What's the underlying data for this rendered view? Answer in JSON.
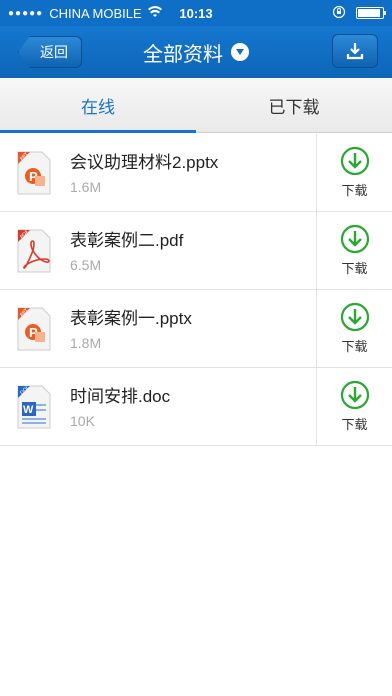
{
  "status": {
    "carrier": "CHINA MOBILE",
    "time": "10:13"
  },
  "nav": {
    "back_label": "返回",
    "title": "全部资料"
  },
  "tabs": [
    {
      "label": "在线",
      "active": true
    },
    {
      "label": "已下载",
      "active": false
    }
  ],
  "files": [
    {
      "name": "会议助理材料2.pptx",
      "size": "1.6M",
      "type": "ppt",
      "action": "下载"
    },
    {
      "name": "表彰案例二.pdf",
      "size": "6.5M",
      "type": "pdf",
      "action": "下载"
    },
    {
      "name": "表彰案例一.pptx",
      "size": "1.8M",
      "type": "ppt",
      "action": "下载"
    },
    {
      "name": "时间安排.doc",
      "size": "10K",
      "type": "doc",
      "action": "下载"
    }
  ],
  "colors": {
    "brand_blue": "#0f6fc6",
    "download_green": "#2aa832",
    "tab_active": "#1a73c8"
  }
}
